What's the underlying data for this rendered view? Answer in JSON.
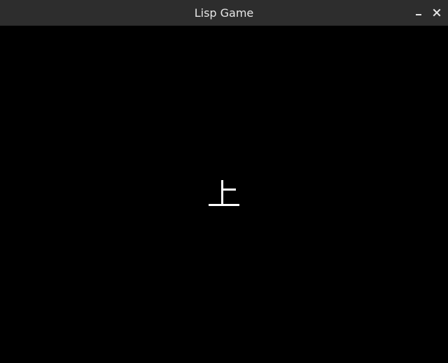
{
  "window": {
    "title": "Lisp Game",
    "controls": {
      "minimize_icon": "minimize-icon",
      "close_icon": "close-icon"
    }
  },
  "game": {
    "background_color": "#000000",
    "glyph_color": "#ffffff",
    "glyph_icon": "up-character-sprite"
  }
}
